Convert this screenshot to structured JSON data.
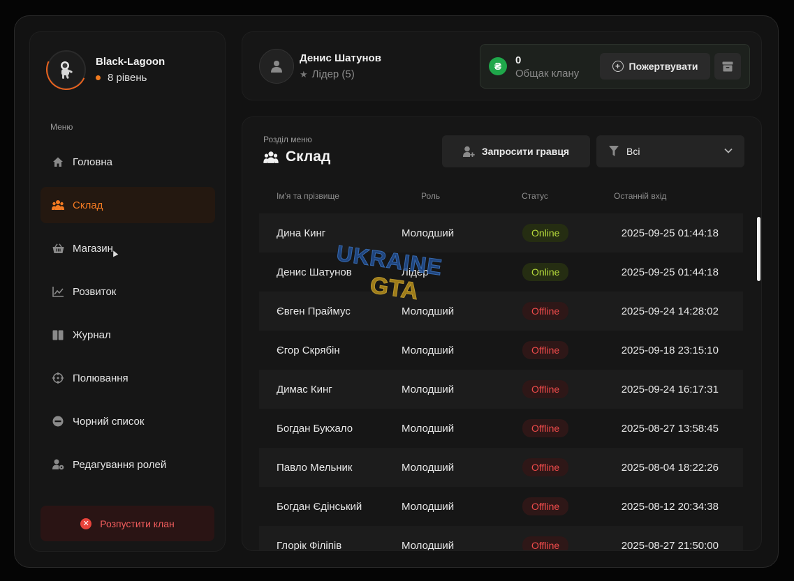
{
  "clan": {
    "name": "Black-Lagoon",
    "level": "8 рівень"
  },
  "menu": {
    "caption": "Меню",
    "items": [
      {
        "label": "Головна",
        "icon": "home-icon"
      },
      {
        "label": "Склад",
        "icon": "users-icon",
        "active": true
      },
      {
        "label": "Магазин",
        "icon": "basket-icon"
      },
      {
        "label": "Розвиток",
        "icon": "chart-icon"
      },
      {
        "label": "Журнал",
        "icon": "book-icon"
      },
      {
        "label": "Полювання",
        "icon": "crosshair-icon"
      },
      {
        "label": "Чорний список",
        "icon": "block-icon"
      },
      {
        "label": "Редагування ролей",
        "icon": "user-settings-icon"
      }
    ],
    "disband_label": "Розпустити клан"
  },
  "header": {
    "user_name": "Денис Шатунов",
    "user_role": "Лідер (5)",
    "treasury_amount": "0",
    "treasury_label": "Общак клану",
    "currency_symbol": "₴",
    "donate_label": "Пожертвувати"
  },
  "section": {
    "caption": "Розділ меню",
    "title": "Склад",
    "invite_label": "Запросити гравця",
    "filter_value": "Всі"
  },
  "table": {
    "columns": [
      "Ім'я та прізвище",
      "Роль",
      "Статус",
      "Останній вхід"
    ],
    "rows": [
      {
        "name": "Дина Кинг",
        "role": "Молодший",
        "status": "Online",
        "last": "2025-09-25 01:44:18"
      },
      {
        "name": "Денис Шатунов",
        "role": "Лідер",
        "status": "Online",
        "last": "2025-09-25 01:44:18"
      },
      {
        "name": "Євген Праймус",
        "role": "Молодший",
        "status": "Offline",
        "last": "2025-09-24 14:28:02"
      },
      {
        "name": "Єгор Скрябін",
        "role": "Молодший",
        "status": "Offline",
        "last": "2025-09-18 23:15:10"
      },
      {
        "name": "Димас Кинг",
        "role": "Молодший",
        "status": "Offline",
        "last": "2025-09-24 16:17:31"
      },
      {
        "name": "Богдан Букхало",
        "role": "Молодший",
        "status": "Offline",
        "last": "2025-08-27 13:58:45"
      },
      {
        "name": "Павло Мельник",
        "role": "Молодший",
        "status": "Offline",
        "last": "2025-08-04 18:22:26"
      },
      {
        "name": "Богдан Єдінський",
        "role": "Молодший",
        "status": "Offline",
        "last": "2025-08-12 20:34:38"
      },
      {
        "name": "Глорік Філіпів",
        "role": "Молодший",
        "status": "Offline",
        "last": "2025-08-27 21:50:00"
      }
    ]
  },
  "watermark": {
    "line1": "UKRAINE",
    "line2": "GTA"
  },
  "colors": {
    "accent": "#f37a22",
    "online": "#b6da3c",
    "offline": "#ef4b4b",
    "money": "#1fa74a"
  }
}
